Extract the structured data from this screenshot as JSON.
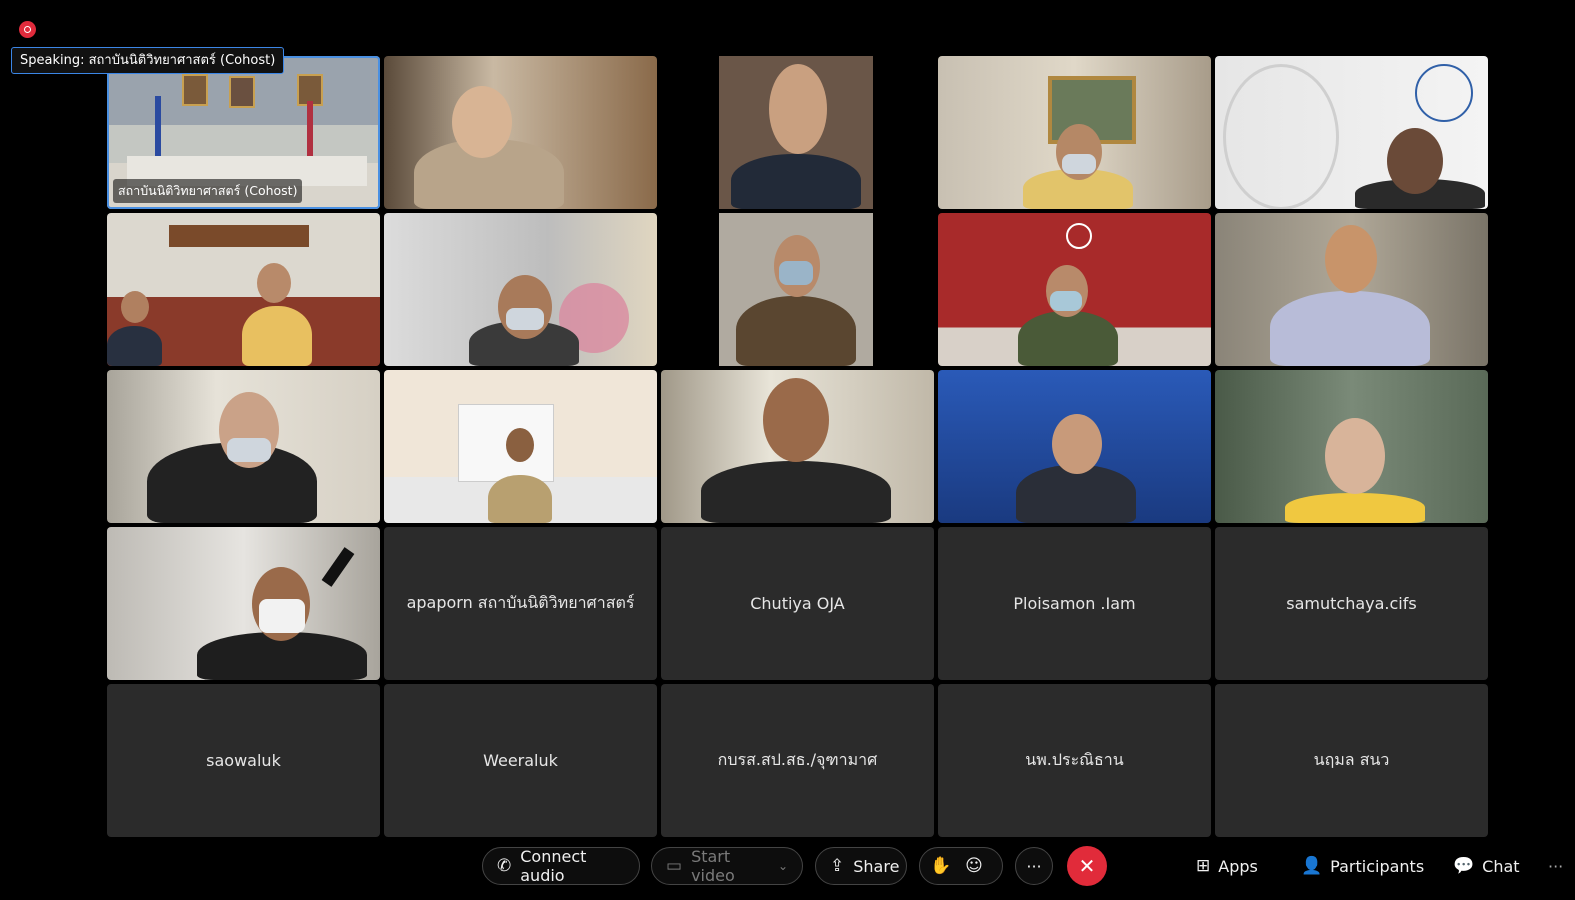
{
  "recording_indicator": "record-icon",
  "speaking": {
    "label": "Speaking:",
    "name": "สถาบันนิติวิทยาศาสตร์ (Cohost)"
  },
  "tiles": [
    {
      "name": "สถาบันนิติวิทยาศาสตร์ (Cohost)",
      "video": true,
      "active": true,
      "show_name": true
    },
    {
      "name": "",
      "video": true
    },
    {
      "name": "",
      "video": true
    },
    {
      "name": "",
      "video": true
    },
    {
      "name": "",
      "video": true
    },
    {
      "name": "",
      "video": true
    },
    {
      "name": "",
      "video": true
    },
    {
      "name": "",
      "video": true
    },
    {
      "name": "",
      "video": true
    },
    {
      "name": "",
      "video": true
    },
    {
      "name": "",
      "video": true
    },
    {
      "name": "",
      "video": true
    },
    {
      "name": "",
      "video": true
    },
    {
      "name": "",
      "video": true
    },
    {
      "name": "",
      "video": true
    },
    {
      "name": "",
      "video": true
    },
    {
      "name": "apaporn สถาบันนิติวิทยาศาสตร์",
      "video": false
    },
    {
      "name": "Chutiya OJA",
      "video": false
    },
    {
      "name": "Ploisamon .Iam",
      "video": false
    },
    {
      "name": "samutchaya.cifs",
      "video": false
    },
    {
      "name": "saowaluk",
      "video": false
    },
    {
      "name": "Weeraluk",
      "video": false
    },
    {
      "name": "กบรส.สป.สธ./จุฑามาศ",
      "video": false
    },
    {
      "name": "นพ.ประณิธาน",
      "video": false
    },
    {
      "name": "นฤมล สนว",
      "video": false
    }
  ],
  "toolbar": {
    "connect_audio": "Connect audio",
    "start_video": "Start video",
    "share": "Share",
    "more": "···",
    "apps": "Apps",
    "participants": "Participants",
    "chat": "Chat",
    "overflow": "···",
    "end_color": "#e12b3a"
  },
  "colors": {
    "background": "#000000",
    "tile_empty": "#2b2b2b",
    "active_border": "#4a90e2",
    "record": "#e02b3c"
  }
}
